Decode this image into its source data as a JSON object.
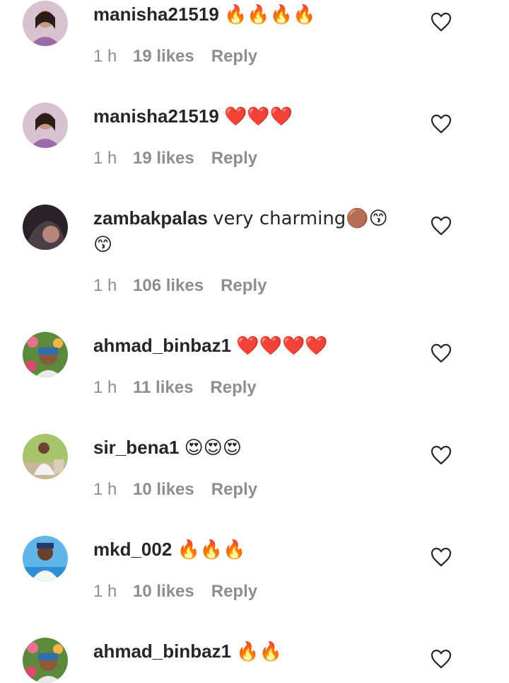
{
  "comments": [
    {
      "username": "manisha21519",
      "text": "🔥🔥🔥🔥",
      "time": "1 h",
      "likes": "19 likes",
      "reply": "Reply"
    },
    {
      "username": "manisha21519",
      "text": "❤️❤️❤️",
      "time": "1 h",
      "likes": "19 likes",
      "reply": "Reply"
    },
    {
      "username": "zambakpalas",
      "text": "very charming🟤😙😙",
      "time": "1 h",
      "likes": "106 likes",
      "reply": "Reply"
    },
    {
      "username": "ahmad_binbaz1",
      "text": "❤️❤️❤️❤️",
      "time": "1 h",
      "likes": "11 likes",
      "reply": "Reply"
    },
    {
      "username": "sir_bena1",
      "text": "😍😍😍",
      "time": "1 h",
      "likes": "10 likes",
      "reply": "Reply"
    },
    {
      "username": "mkd_002",
      "text": "🔥🔥🔥",
      "time": "1 h",
      "likes": "10 likes",
      "reply": "Reply"
    },
    {
      "username": "ahmad_binbaz1",
      "text": "🔥🔥",
      "time": "",
      "likes": "",
      "reply": ""
    }
  ],
  "icons": {
    "like": "heart-outline-icon"
  },
  "colors": {
    "text": "#262626",
    "meta": "#8e8e8e",
    "background": "#ffffff"
  }
}
